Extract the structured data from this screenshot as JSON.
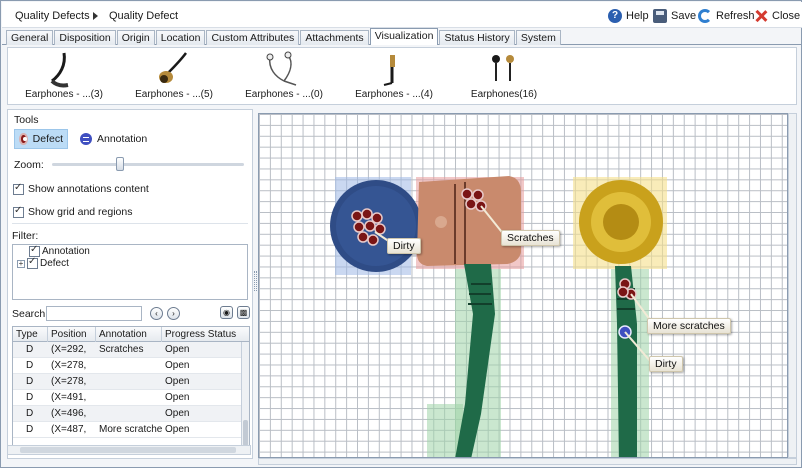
{
  "breadcrumb": {
    "parent": "Quality Defects",
    "current": "Quality Defect"
  },
  "toolbar": {
    "help": "Help",
    "save": "Save",
    "refresh": "Refresh",
    "close": "Close"
  },
  "tabs": [
    {
      "label": "General"
    },
    {
      "label": "Disposition"
    },
    {
      "label": "Origin"
    },
    {
      "label": "Location"
    },
    {
      "label": "Custom Attributes"
    },
    {
      "label": "Attachments"
    },
    {
      "label": "Visualization",
      "active": true
    },
    {
      "label": "Status History"
    },
    {
      "label": "System"
    }
  ],
  "thumbnails": [
    {
      "label": "Earphones - ...(3)"
    },
    {
      "label": "Earphones - ...(5)"
    },
    {
      "label": "Earphones - ...(0)"
    },
    {
      "label": "Earphones - ...(4)"
    },
    {
      "label": "Earphones(16)"
    }
  ],
  "tools": {
    "title": "Tools",
    "defect": "Defect",
    "annotation": "Annotation",
    "zoom_label": "Zoom:",
    "zoom_level": 0.35,
    "show_annotations": "Show annotations content",
    "show_grid": "Show grid and regions",
    "show_annotations_checked": true,
    "show_grid_checked": true
  },
  "filter": {
    "label": "Filter:",
    "items": [
      {
        "label": "Annotation",
        "checked": true
      },
      {
        "label": "Defect",
        "checked": true
      }
    ]
  },
  "search": {
    "label": "Search:",
    "value": "",
    "placeholder": ""
  },
  "table": {
    "columns": [
      "Type",
      "Position",
      "Annotation",
      "Progress Status"
    ],
    "rows": [
      {
        "type": "D",
        "position": "(X=292,",
        "annotation": "Scratches",
        "status": "Open"
      },
      {
        "type": "D",
        "position": "(X=278,",
        "annotation": "",
        "status": "Open"
      },
      {
        "type": "D",
        "position": "(X=278,",
        "annotation": "",
        "status": "Open"
      },
      {
        "type": "D",
        "position": "(X=491,",
        "annotation": "",
        "status": "Open"
      },
      {
        "type": "D",
        "position": "(X=496,",
        "annotation": "",
        "status": "Open"
      },
      {
        "type": "D",
        "position": "(X=487,",
        "annotation": "More scratches",
        "status": "Open"
      }
    ]
  },
  "canvas_labels": {
    "dirty_left": "Dirty",
    "scratches": "Scratches",
    "more_scratches": "More scratches",
    "dirty_right": "Dirty"
  },
  "colors": {
    "defect": "#8b1a1a",
    "annotation": "#3f4fc0",
    "region_blue": "#9fb8e6",
    "region_red": "#e89a9a",
    "region_yellow": "#f5df8a",
    "region_green": "#9ed4a8"
  }
}
